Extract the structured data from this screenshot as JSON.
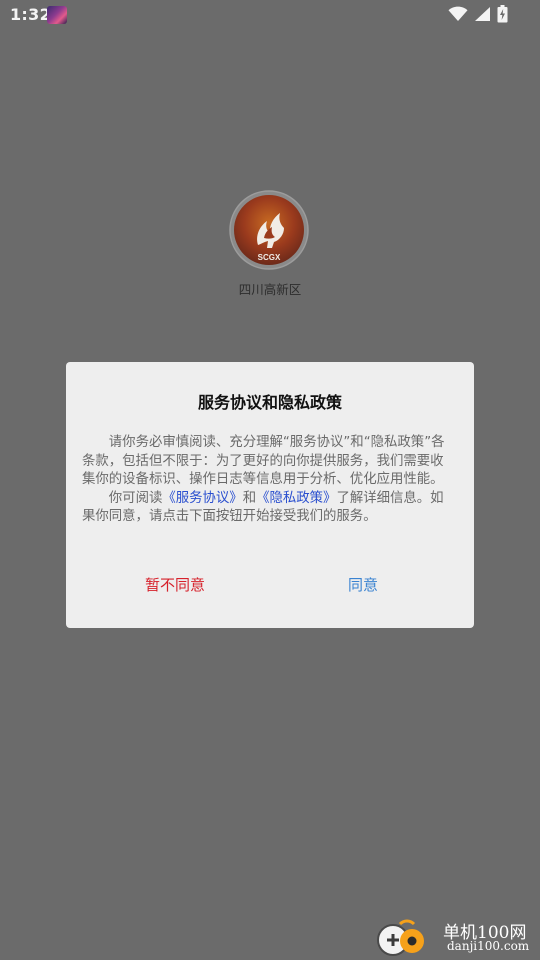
{
  "status_bar": {
    "time": "1:32",
    "icons": [
      "notification-image-icon",
      "wifi-icon",
      "signal-icon",
      "battery-charging-icon"
    ]
  },
  "splash": {
    "logo_text": "SCGX",
    "app_name": "四川高新区"
  },
  "dialog": {
    "title": "服务协议和隐私政策",
    "para1": "请你务必审慎阅读、充分理解“服务协议”和“隐私政策”各条款，包括但不限于：为了更好的向你提供服务，我们需要收集你的设备标识、操作日志等信息用于分析、优化应用性能。",
    "para2_pre": "你可阅读",
    "link_service": "《服务协议》",
    "para2_and": "和",
    "link_privacy": "《隐私政策》",
    "para2_post": "了解详细信息。如果你同意，请点击下面按钮开始接受我们的服务。",
    "disagree_label": "暂不同意",
    "agree_label": "同意",
    "colors": {
      "disagree": "#d6212b",
      "agree": "#3a83d1",
      "link": "#2a4fcf"
    }
  },
  "watermark": {
    "title": "单机100网",
    "domain": "danji100.com"
  }
}
